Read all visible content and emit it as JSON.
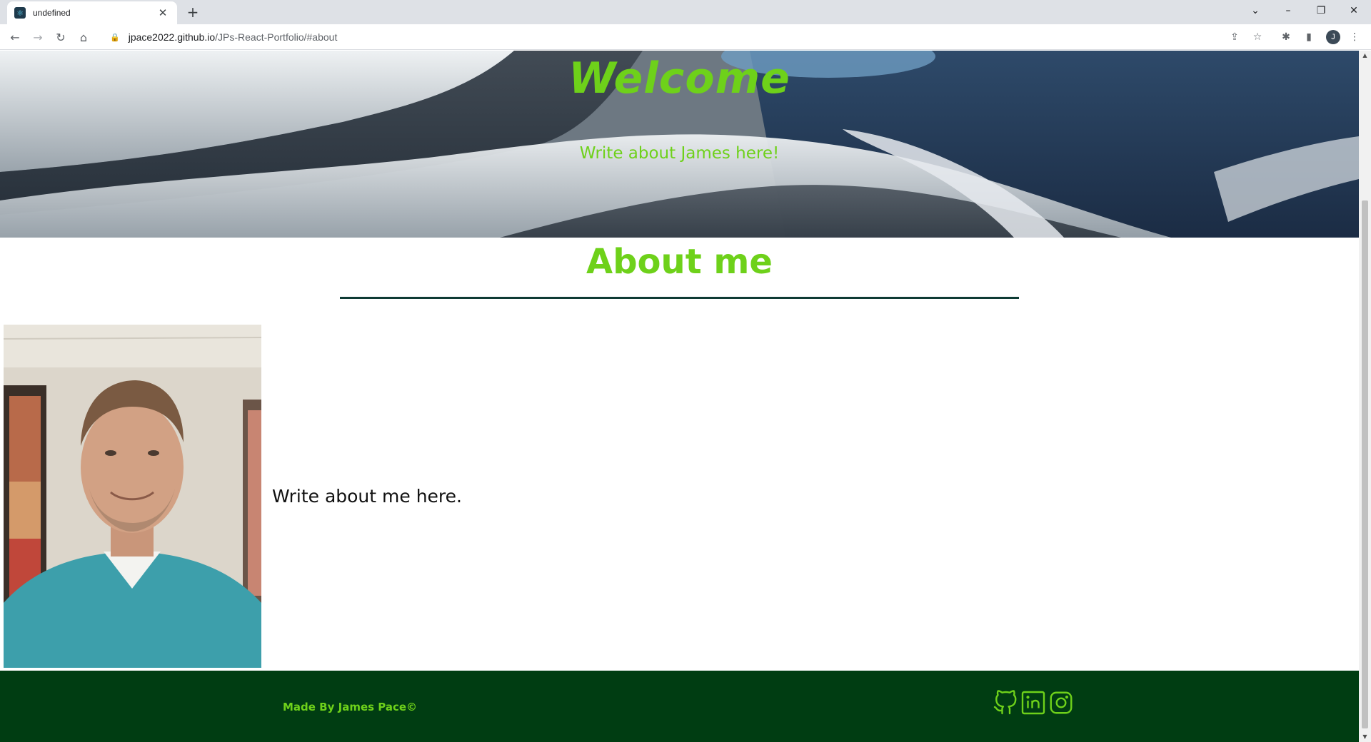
{
  "browser": {
    "tab_title": "undefined",
    "new_tab_label": "+",
    "url_host": "jpace2022.github.io",
    "url_path": "/JPs-React-Portfolio/#about",
    "profile_initial": "J"
  },
  "hero": {
    "title": "Welcome",
    "subtitle": "Write about James here!"
  },
  "about": {
    "heading": "About me",
    "text": "Write about me here."
  },
  "footer": {
    "credit": "Made By James Pace©",
    "social_icons": [
      "github-icon",
      "linkedin-icon",
      "instagram-icon"
    ]
  },
  "colors": {
    "accent_green": "#6ed11a",
    "footer_bg": "#003d12",
    "rule": "#0e3b34"
  }
}
